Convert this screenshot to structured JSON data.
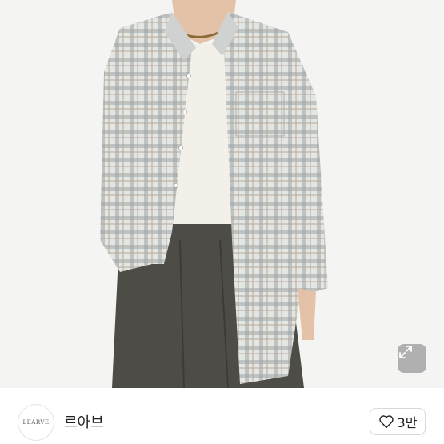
{
  "store": {
    "logo_text": "LEARVE",
    "name": "르아브"
  },
  "like": {
    "count": "3만",
    "icon": "heart-outline-icon"
  },
  "photo": {
    "expand_icon": "expand-arrows-icon"
  },
  "colors": {
    "shirt": "#d8dbd9",
    "pants": "#4e4c47",
    "tee": "#f3f0ea",
    "skin": "#e3c2a8"
  }
}
